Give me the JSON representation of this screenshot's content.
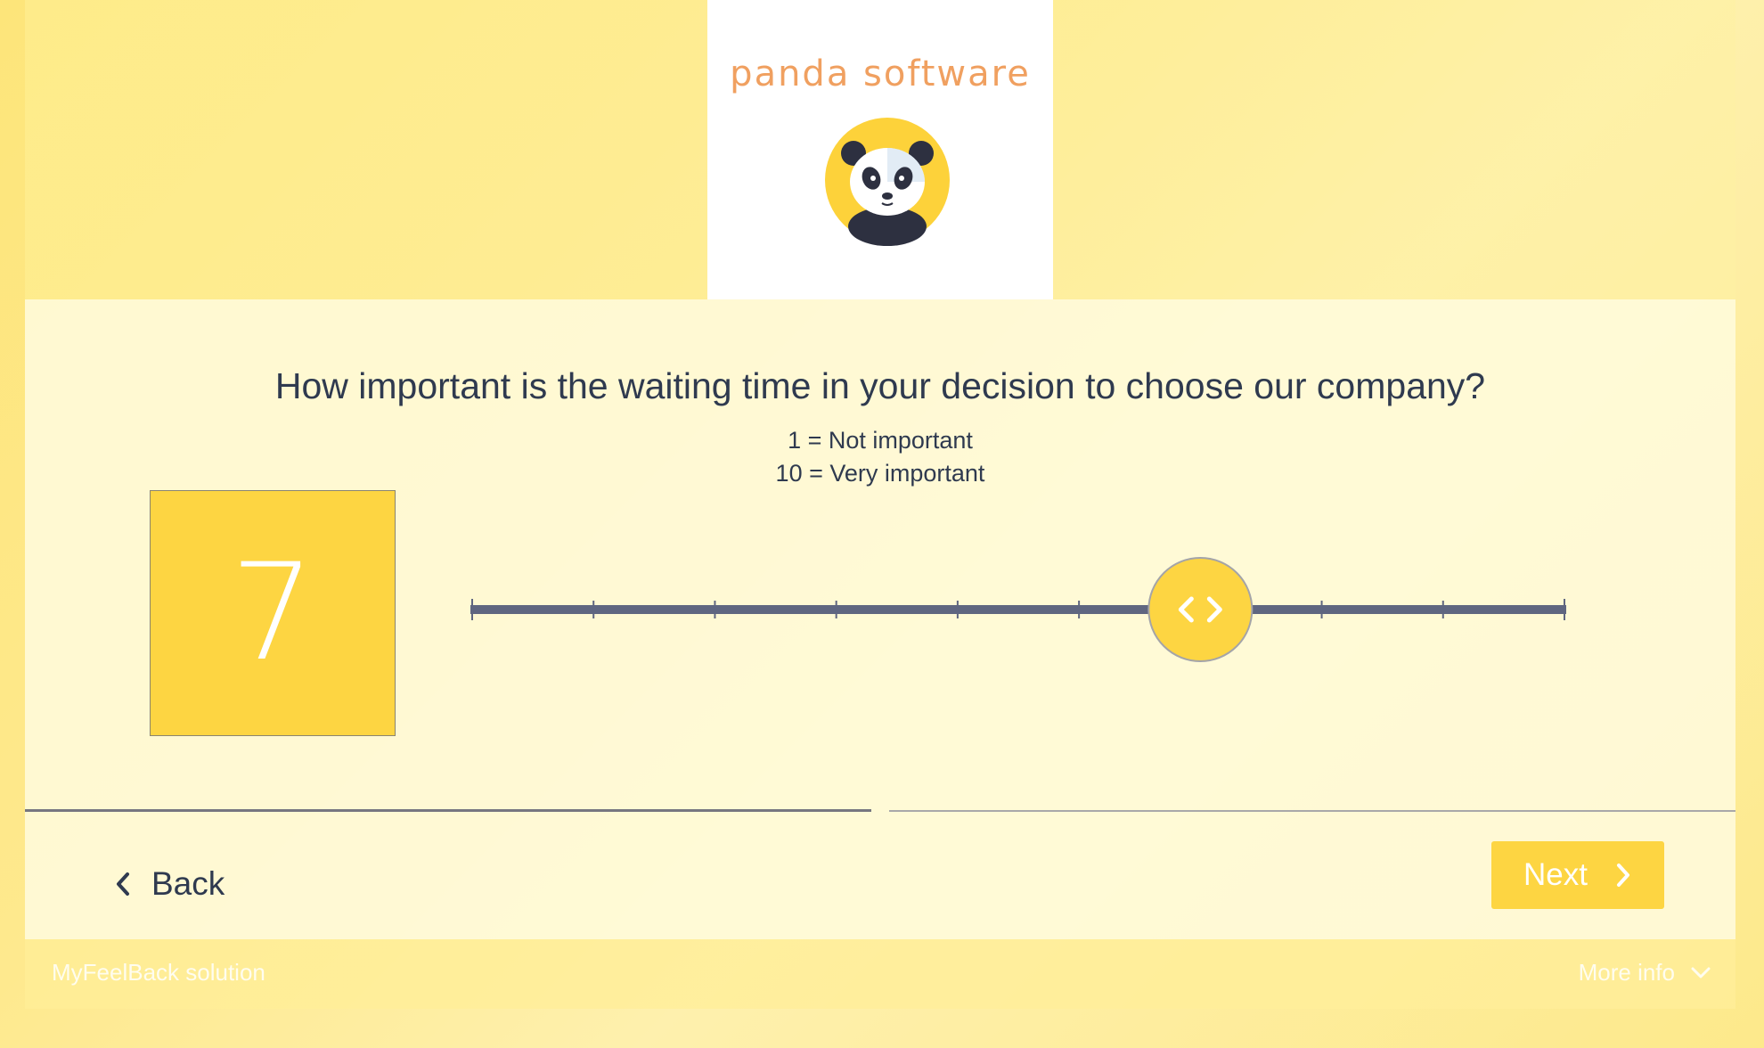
{
  "brand": {
    "logo_text": "panda software"
  },
  "question": {
    "text": "How important is the waiting time in your decision to choose our company?",
    "legend_min": "1 = Not important",
    "legend_max": "10 = Very important"
  },
  "slider": {
    "min": 1,
    "max": 10,
    "value": 7,
    "value_display": "7",
    "handle_icon": "left-right-chevrons-icon"
  },
  "navigation": {
    "back_label": "Back",
    "back_icon": "chevron-left-icon",
    "next_label": "Next",
    "next_icon": "chevron-right-icon"
  },
  "footer": {
    "brand": "MyFeelBack solution",
    "more_info": "More info",
    "more_info_icon": "chevron-down-icon"
  },
  "colors": {
    "accent": "#fdd542",
    "track": "#5f6680",
    "text": "#2f3a4f",
    "logo_text": "#f0a060"
  }
}
